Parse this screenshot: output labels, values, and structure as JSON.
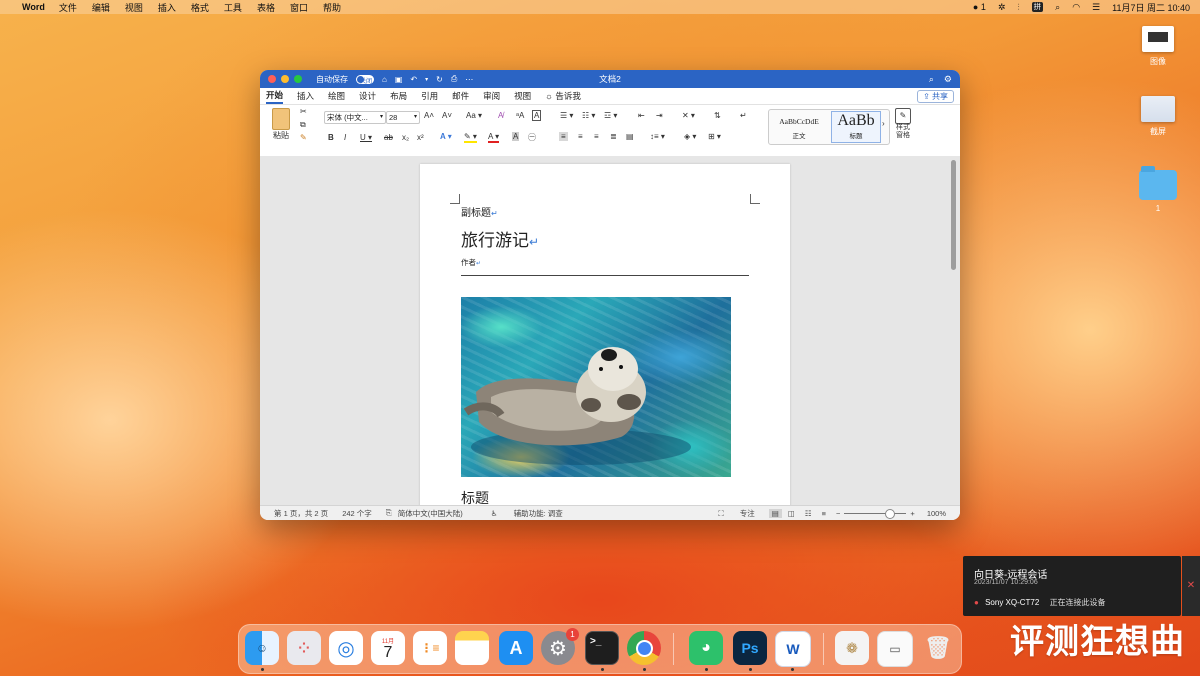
{
  "menubar": {
    "app": "Word",
    "items": [
      "文件",
      "编辑",
      "视图",
      "插入",
      "格式",
      "工具",
      "表格",
      "窗口",
      "帮助"
    ],
    "status": {
      "wechat_count": "1",
      "input": "拼",
      "datetime": "11月7日 周二  10:40"
    }
  },
  "desktop": {
    "items": [
      {
        "label": "图像"
      },
      {
        "label": "截屏"
      },
      {
        "label": "1"
      }
    ]
  },
  "word": {
    "autosave_label": "自动保存",
    "autosave_state": "关闭",
    "doc_title": "文档2",
    "tabs": [
      "开始",
      "插入",
      "绘图",
      "设计",
      "布局",
      "引用",
      "邮件",
      "审阅",
      "视图"
    ],
    "tell_me": "告诉我",
    "share": "共享",
    "ribbon": {
      "paste": "粘贴",
      "font_name": "宋体 (中文...",
      "font_size": "28",
      "case_btn": "Aa",
      "style_normal_preview": "AaBbCcDdE",
      "style_normal": "正文",
      "style_heading_preview": "AaBb",
      "style_heading": "标题",
      "styles_pane": "样式\n窗格"
    },
    "document": {
      "subtitle": "副标题",
      "title": "旅行游记",
      "author": "作者",
      "next_heading": "标题"
    },
    "status": {
      "page": "第 1 页，共 2 页",
      "words": "242 个字",
      "language": "简体中文(中国大陆)",
      "accessibility": "辅助功能: 调查",
      "focus": "专注",
      "zoom": "100%"
    }
  },
  "notification": {
    "title": "向日葵-远程会话",
    "time": "2023/11/07 10:29:06",
    "device": "Sony XQ-CT72",
    "message": "正在连接此设备"
  },
  "dock": {
    "calendar_month": "11月",
    "calendar_day": "7",
    "settings_badge": "1",
    "ps": "Ps",
    "word": "W"
  },
  "watermark": "评测狂想曲"
}
